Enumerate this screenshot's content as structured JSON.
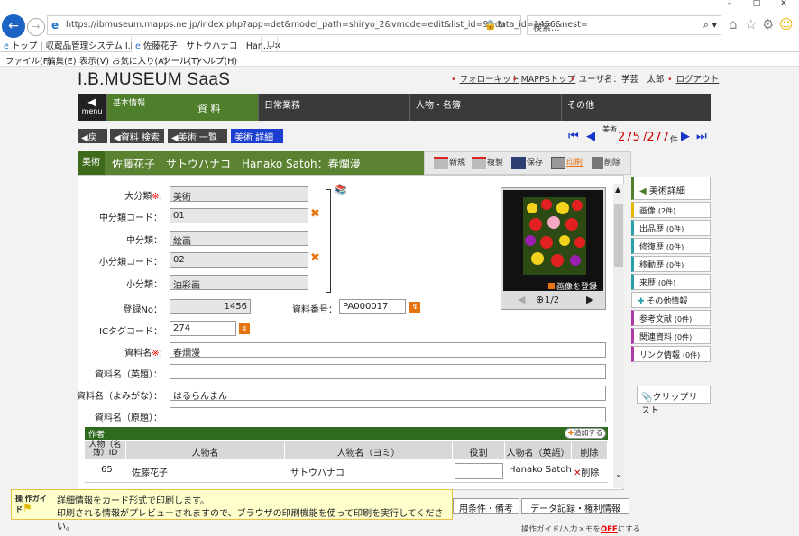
{
  "browser": {
    "url": "https://ibmuseum.mapps.ne.jp/index.php?app=det&model_path=shiryo_2&vmode=edit&list_id=9&data_id=1456&nest=",
    "search_placeholder": "検索...",
    "tabs": [
      {
        "label": "トップ | 収蔵品管理システム I.B.M..."
      },
      {
        "label": "佐藤花子　サトウハナコ　Han..."
      }
    ],
    "menu": [
      "ファイル(F)",
      "編集(E)",
      "表示(V)",
      "お気に入り(A)",
      "ツール(T)",
      "ヘルプ(H)"
    ]
  },
  "header": {
    "logo": "I.B.MUSEUM SaaS",
    "links": [
      "フォローキット",
      "MAPPSトップ"
    ],
    "user_label": "ユーザ名：学芸　太郎",
    "logout": "ログアウト"
  },
  "nav": {
    "menu_label": "menu",
    "kihon_sub": "基本情報",
    "kihon_main": "資 料",
    "items": [
      "日常業務",
      "人物・名簿",
      "その他"
    ]
  },
  "breadcrumb": [
    "戻る",
    "資料 検索",
    "美術 一覧",
    "美術 詳細"
  ],
  "record_nav": {
    "label": "美術",
    "current": "275",
    "total": "/277",
    "unit": "件"
  },
  "record": {
    "category": "美術",
    "title": "佐藤花子　サトウハナコ　Hanako Satoh：春爛漫"
  },
  "toolbar": [
    "新規",
    "複製",
    "保存",
    "印刷",
    "削除"
  ],
  "form": {
    "dai_label": "大分類",
    "dai_value": "美術",
    "chu_code_label": "中分類コード：",
    "chu_code_value": "01",
    "chu_label": "中分類：",
    "chu_value": "絵画",
    "sho_code_label": "小分類コード：",
    "sho_code_value": "02",
    "sho_label": "小分類：",
    "sho_value": "油彩画",
    "reg_label": "登録No：",
    "reg_value": "1456",
    "shiryo_no_label": "資料番号：",
    "shiryo_no_value": "PA000017",
    "ic_label": "ICタグコード：",
    "ic_value": "274",
    "name_label": "資料名",
    "name_value": "春爛漫",
    "name_en_label": "資料名（英題）：",
    "name_en_value": "",
    "name_kana_label": "資料名（よみがな）：",
    "name_kana_value": "はるらんまん",
    "name_orig_label": "資料名（原題）：",
    "name_orig_value": ""
  },
  "image_box": {
    "register": "画像を登録",
    "page": "1/2"
  },
  "authors": {
    "section": "作者",
    "add": "追加する",
    "columns": [
      "人物（名簿）ID",
      "人物名",
      "人物名（ヨミ）",
      "役割",
      "人物名（英語）",
      "削除"
    ],
    "rows": [
      {
        "id": "65",
        "name": "佐藤花子",
        "yomi": "サトウハナコ",
        "role": "",
        "en": "Hanako Satoh",
        "del": "削除"
      }
    ]
  },
  "side_menu": [
    {
      "label": "美術詳細",
      "count": ""
    },
    {
      "label": "画像",
      "count": "(2件)"
    },
    {
      "label": "出品歴",
      "count": "(0件)"
    },
    {
      "label": "修復歴",
      "count": "(0件)"
    },
    {
      "label": "移動歴",
      "count": "(0件)"
    },
    {
      "label": "来歴",
      "count": "(0件)"
    },
    {
      "label": "その他情報",
      "count": ""
    },
    {
      "label": "参考文献",
      "count": "(0件)"
    },
    {
      "label": "関連資料",
      "count": "(0件)"
    },
    {
      "label": "リンク情報",
      "count": "(0件)"
    }
  ],
  "clip_list": "クリップリスト",
  "guide": {
    "icon_label": "操 作ガイド",
    "line1": "詳細情報をカード形式で印刷します。",
    "line2": "印刷される情報がプレビューされますので、ブラウザの印刷機能を使って印刷を実行してください。"
  },
  "bottom_tabs": [
    "用条件・備考",
    "データ記録・権利情報"
  ],
  "footnote": {
    "text": "操作ガイド/入力メモを",
    "off": "OFF",
    "suffix": "にする"
  },
  "colors": {
    "nav_green": "#4f7f2a",
    "breadcrumb_active": "#1c3fd0",
    "record_nav_blue": "#1634c9",
    "accent_orange": "#e87410"
  }
}
